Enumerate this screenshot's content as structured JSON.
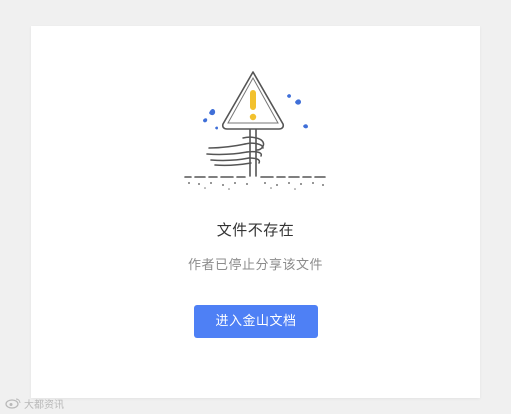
{
  "main": {
    "title": "文件不存在",
    "subtitle": "作者已停止分享该文件",
    "enter_button_label": "进入金山文档"
  },
  "watermark": {
    "text": "大都资讯",
    "icon": "weibo-logo-icon"
  },
  "illustration": {
    "icon": "warning-sign-icon"
  },
  "colors": {
    "primary_button": "#4e80f5",
    "warning_accent": "#f2c12e",
    "splash_blue": "#3f6fd8",
    "background": "#f0f0f0",
    "card": "#ffffff"
  }
}
